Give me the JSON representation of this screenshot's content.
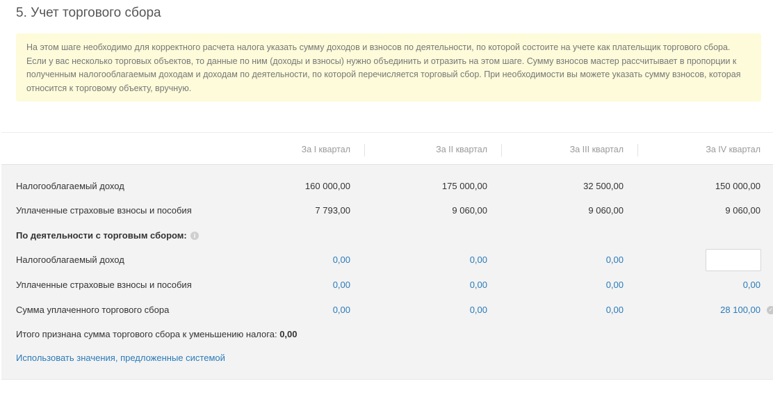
{
  "title": "5. Учет торгового сбора",
  "note": "На этом шаге необходимо для корректного расчета налога указать сумму доходов и взносов по деятельности, по которой состоите на учете как плательщик торгового сбора. Если у вас несколько торговых объектов, то данные по ним (доходы и взносы) нужно объединить и отразить на этом шаге. Сумму взносов мастер рассчитывает в пропорции к полученным налогооблагаемым доходам и доходам по деятельности, по которой перечисляется торговый сбор. При необходимости вы можете указать сумму взносов, которая относится к торговому объекту, вручную.",
  "columns": [
    "За I квартал",
    "За II квартал",
    "За III квартал",
    "За IV квартал"
  ],
  "rows": [
    {
      "label": "Налогооблагаемый доход",
      "values": [
        "160 000,00",
        "175 000,00",
        "32 500,00",
        "150 000,00"
      ]
    },
    {
      "label": "Уплаченные страховые взносы и пособия",
      "values": [
        "7 793,00",
        "9 060,00",
        "9 060,00",
        "9 060,00"
      ]
    }
  ],
  "section": {
    "title": "По деятельности с торговым сбором:",
    "info_icon": "info-icon",
    "rows": [
      {
        "label": "Налогооблагаемый доход",
        "values": [
          "0,00",
          "0,00",
          "0,00"
        ],
        "input_value": ""
      },
      {
        "label": "Уплаченные страховые взносы и пособия",
        "values": [
          "0,00",
          "0,00",
          "0,00",
          "0,00"
        ]
      },
      {
        "label": "Сумма уплаченного торгового сбора",
        "values": [
          "0,00",
          "0,00",
          "0,00",
          "28 100,00"
        ],
        "trailing_icon": "check-circle-icon"
      }
    ]
  },
  "total": {
    "label": "Итого признана сумма торгового сбора к уменьшению налога:",
    "value": "0,00"
  },
  "link": "Использовать значения, предложенные системой",
  "colors": {
    "link": "#2a7ab8",
    "note_bg": "#fdfbd9",
    "table_bg": "#f3f3f3"
  }
}
